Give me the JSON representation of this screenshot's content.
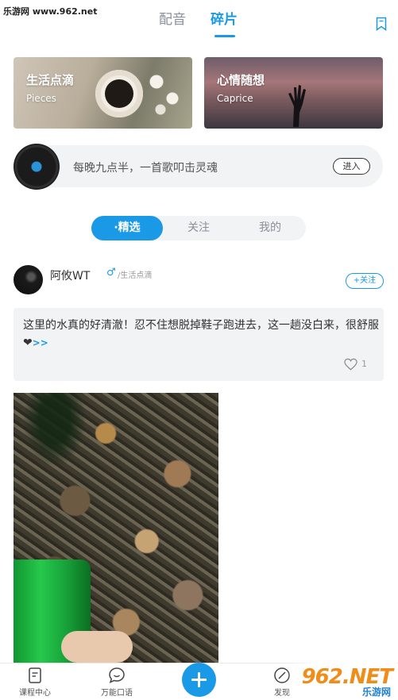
{
  "watermark": {
    "top_text": "乐游网 www.962.net",
    "logo_text": "962.NET",
    "logo_sub": "乐游网"
  },
  "top_tabs": {
    "tab1": "配音",
    "tab2": "碎片",
    "active": "碎片"
  },
  "banners": [
    {
      "title": "生活点滴",
      "subtitle": "Pieces"
    },
    {
      "title": "心情随想",
      "subtitle": "Caprice"
    }
  ],
  "music_bar": {
    "text": "每晚九点半，一首歌叩击灵魂",
    "button": "进入"
  },
  "segment": {
    "items": [
      "·精选",
      "关注",
      "我的"
    ],
    "selected": "·精选"
  },
  "post": {
    "username": "阿攸WT",
    "gender_symbol": "♂",
    "category": "/生活点滴",
    "follow_label": "+关注",
    "text": "这里的水真的好清澈！忍不住想脱掉鞋子跑进去，这一趟没白来，很舒服❤",
    "more_label": ">>",
    "likes": "1"
  },
  "tabbar": {
    "items": [
      "课程中心",
      "万能口语",
      "发现"
    ]
  },
  "colors": {
    "accent": "#1a9ae6",
    "background": "#ffffff",
    "card": "#f2f3f5"
  }
}
